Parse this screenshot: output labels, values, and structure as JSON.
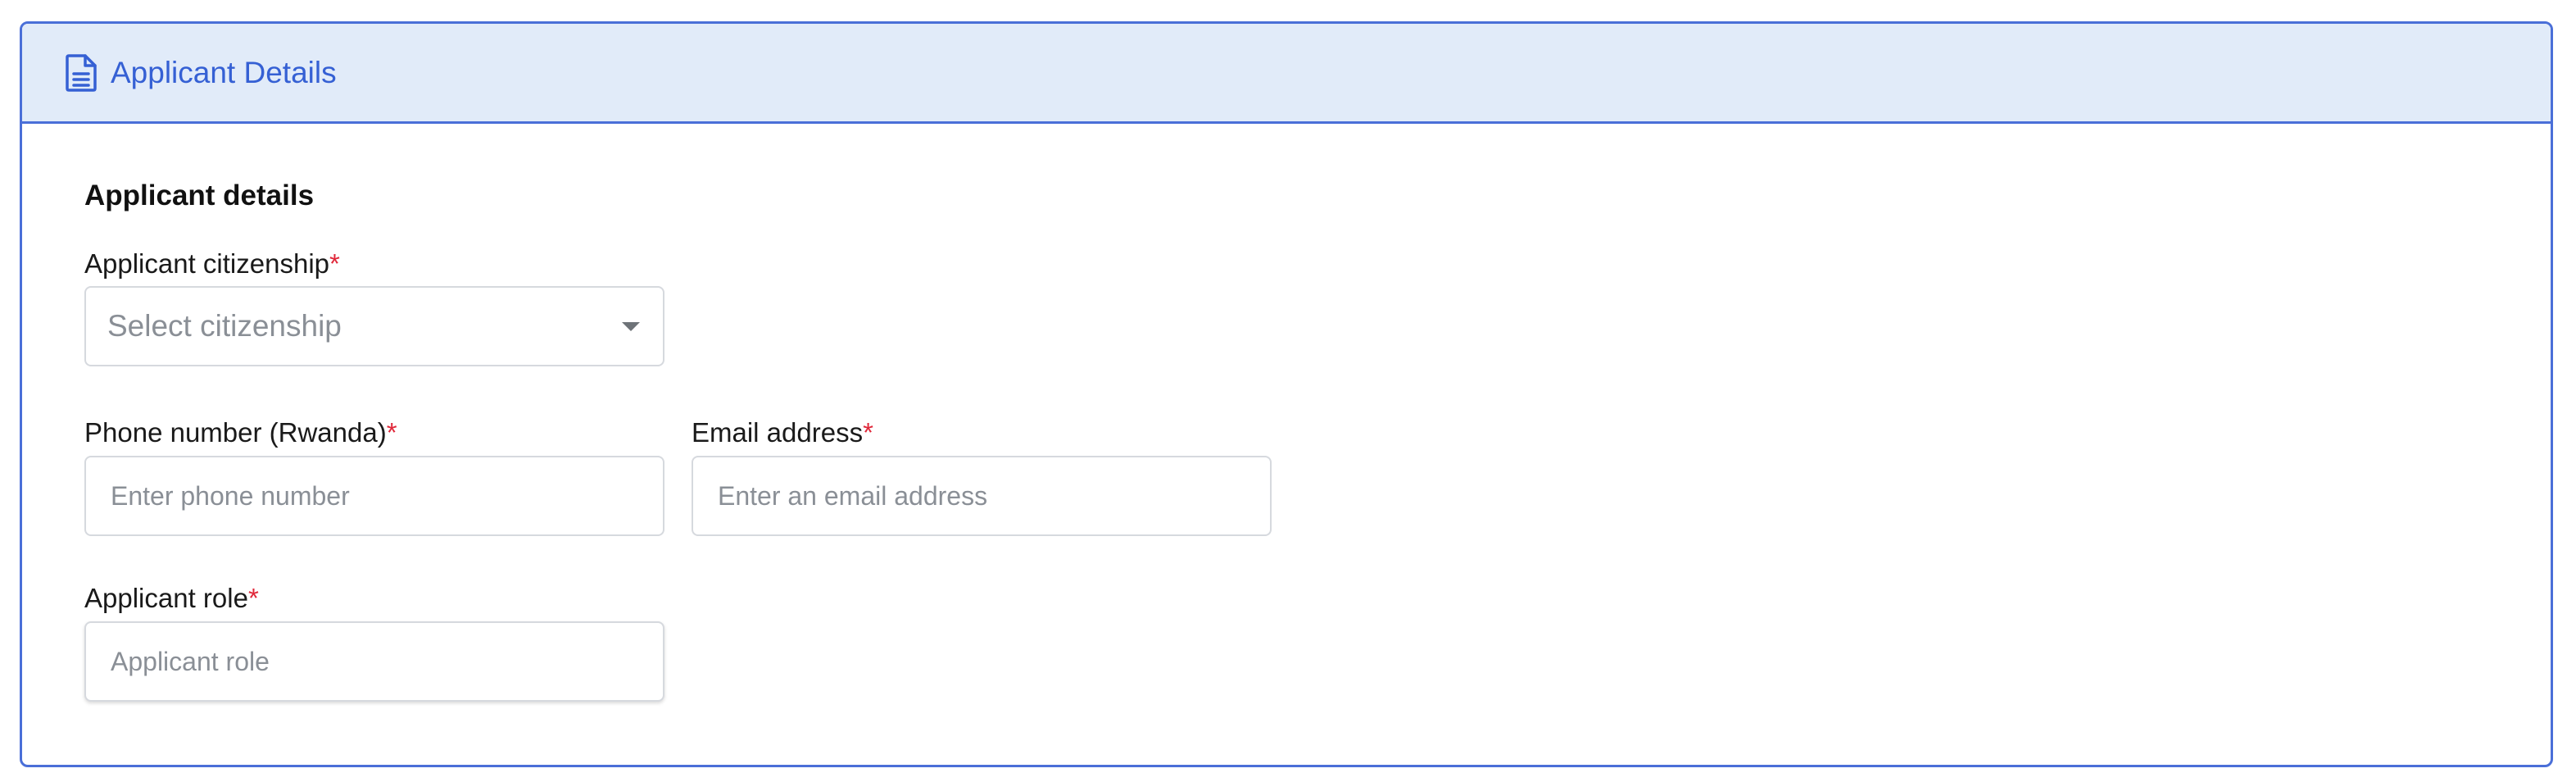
{
  "header": {
    "icon": "document-icon",
    "title": "Applicant Details"
  },
  "section": {
    "title": "Applicant details"
  },
  "fields": {
    "citizenship": {
      "label": "Applicant citizenship",
      "required_mark": "*",
      "placeholder": "Select citizenship",
      "value": ""
    },
    "phone": {
      "label": "Phone number (Rwanda)",
      "required_mark": "*",
      "placeholder": "Enter phone number",
      "value": ""
    },
    "email": {
      "label": "Email address",
      "required_mark": "*",
      "placeholder": "Enter an email address",
      "value": ""
    },
    "role": {
      "label": "Applicant role",
      "required_mark": "*",
      "placeholder": "Applicant role",
      "value": ""
    }
  },
  "colors": {
    "accent": "#4a6fd8",
    "header_bg": "#e1ebf9",
    "header_text": "#3560d4",
    "required": "#e0283a"
  }
}
